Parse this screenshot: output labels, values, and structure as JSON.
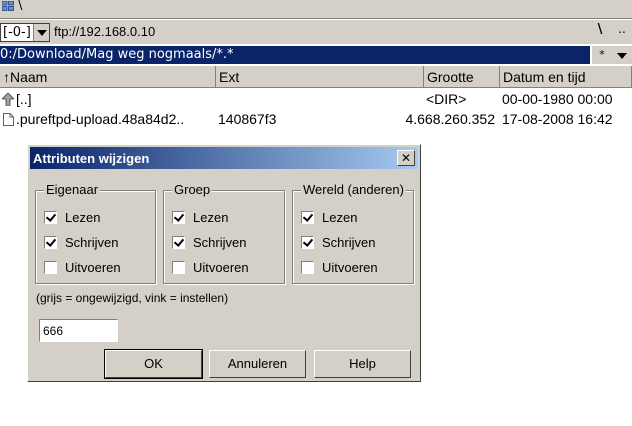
{
  "top": {
    "path": "\\"
  },
  "drive": {
    "value": "[-0-]",
    "label": "ftp://192.168.0.10",
    "root_button": "\\",
    "up_button": ".."
  },
  "path_bar": {
    "text": "0:/Download/Mag weg nogmaals/*.*",
    "star_button": "*"
  },
  "columns": {
    "name": "↑Naam",
    "ext": "Ext",
    "size": "Grootte",
    "date": "Datum en tijd"
  },
  "files": [
    {
      "name": "[..]",
      "ext": "",
      "size": "<DIR>",
      "date": "00-00-1980 00:00"
    },
    {
      "name": ".pureftpd-upload.48a84d2..",
      "ext": "140867f3",
      "size": "4.668.260.352",
      "date": "17-08-2008 16:42"
    }
  ],
  "dialog": {
    "title": "Attributen wijzigen",
    "close": "✕",
    "groups": [
      {
        "legend": "Eigenaar",
        "items": [
          {
            "label": "Lezen",
            "checked": true
          },
          {
            "label": "Schrijven",
            "checked": true
          },
          {
            "label": "Uitvoeren",
            "checked": false
          }
        ]
      },
      {
        "legend": "Groep",
        "items": [
          {
            "label": "Lezen",
            "checked": true
          },
          {
            "label": "Schrijven",
            "checked": true
          },
          {
            "label": "Uitvoeren",
            "checked": false
          }
        ]
      },
      {
        "legend": "Wereld (anderen)",
        "items": [
          {
            "label": "Lezen",
            "checked": true
          },
          {
            "label": "Schrijven",
            "checked": true
          },
          {
            "label": "Uitvoeren",
            "checked": false
          }
        ]
      }
    ],
    "hint": "(grijs = ongewijzigd, vink = instellen)",
    "mode_value": "666",
    "ok": "OK",
    "cancel": "Annuleren",
    "help": "Help"
  },
  "colors": {
    "title_dark": "#0a246a",
    "title_light": "#a6caf0",
    "face": "#d4d0c8",
    "path_bar": "#0a246a"
  }
}
